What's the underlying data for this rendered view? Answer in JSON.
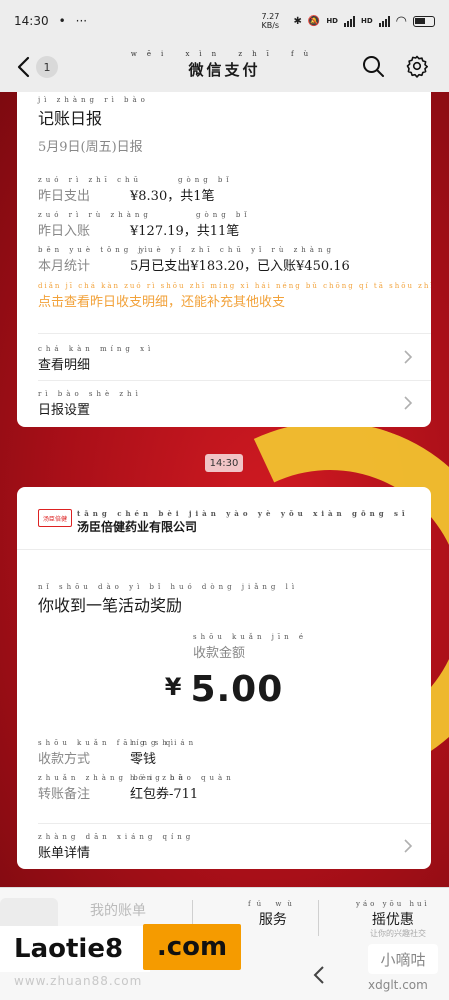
{
  "status_bar": {
    "time": "14:30",
    "network_speed": "7.27 KB/s",
    "signal1_label": "HD",
    "signal2_label": "HD",
    "battery": "69"
  },
  "header": {
    "title": "微信支付",
    "title_pinyin": "wēi xìn zhī fù",
    "badge_count": "1"
  },
  "daily_report": {
    "title": "记账日报",
    "title_pinyin": "jì zhàng rì bào",
    "date": "5月9日(周五)日报",
    "yesterday_expense_label": "昨日支出",
    "yesterday_expense_pinyin": "zuó rì zhī chū",
    "yesterday_expense_value": "¥8.30，共1笔",
    "yesterday_expense_value_pinyin": "gòng bǐ",
    "yesterday_income_label": "昨日入账",
    "yesterday_income_pinyin": "zuó rì rù zhàng",
    "yesterday_income_value": "¥127.19，共11笔",
    "yesterday_income_value_pinyin": "gòng bǐ",
    "monthly_label": "本月统计",
    "monthly_pinyin": "běn yuè tǒng jì",
    "monthly_value": "5月已支出¥183.20，已入账¥450.16",
    "monthly_value_pinyin": "yuè yǐ zhī chū   yǐ rù zhàng",
    "tip": "点击查看昨日收支明细，还能补充其他收支",
    "tip_pinyin": "diǎn jī chá kàn zuó rì shōu zhī míng xì  hái néng bǔ chōng qí tā shōu zhī",
    "details_link": "查看明细",
    "details_link_pinyin": "chá kàn míng xì",
    "settings_link": "日报设置",
    "settings_link_pinyin": "rì bào shè zhì"
  },
  "message_time": "14:30",
  "payment_notice": {
    "merchant_name": "汤臣倍健药业有限公司",
    "merchant_pinyin": "tāng chén bèi jiàn yào yè yǒu xiàn gōng sī",
    "merchant_logo_text": "汤臣倍健",
    "heading": "你收到一笔活动奖励",
    "heading_pinyin": "nǐ shōu dào yì bǐ huó dòng jiǎng lì",
    "amount_label": "收款金额",
    "amount_label_pinyin": "shōu kuǎn jīn é",
    "currency": "¥",
    "amount": "5.00",
    "method_label": "收款方式",
    "method_label_pinyin": "shōu kuǎn fāng shì",
    "method_value": "零钱",
    "method_value_pinyin": "líng qián",
    "note_label": "转账备注",
    "note_label_pinyin": "zhuǎn zhàng bèi zhù",
    "note_value": "红包券-711",
    "note_value_pinyin": "hóng bāo quàn",
    "bill_link": "账单详情",
    "bill_link_pinyin": "zhàng dān xiáng qíng"
  },
  "bottom_menu": {
    "item1": "我的账单",
    "item2": "服务",
    "item2_pinyin": "fú wù",
    "item3": "摇优惠",
    "item3_pinyin": "yáo yōu huì"
  },
  "watermark": {
    "brand": "Laotie8",
    "brand_suffix": ".com",
    "url": "www.zhuan88.com",
    "right_brand": "小嘀咕",
    "right_url": "xdglt.com",
    "right_small": "让你的兴趣社交"
  },
  "colors": {
    "accent_orange": "#f2a23a",
    "background_red": "#b3121b",
    "emblem_gold": "#f2c230"
  }
}
